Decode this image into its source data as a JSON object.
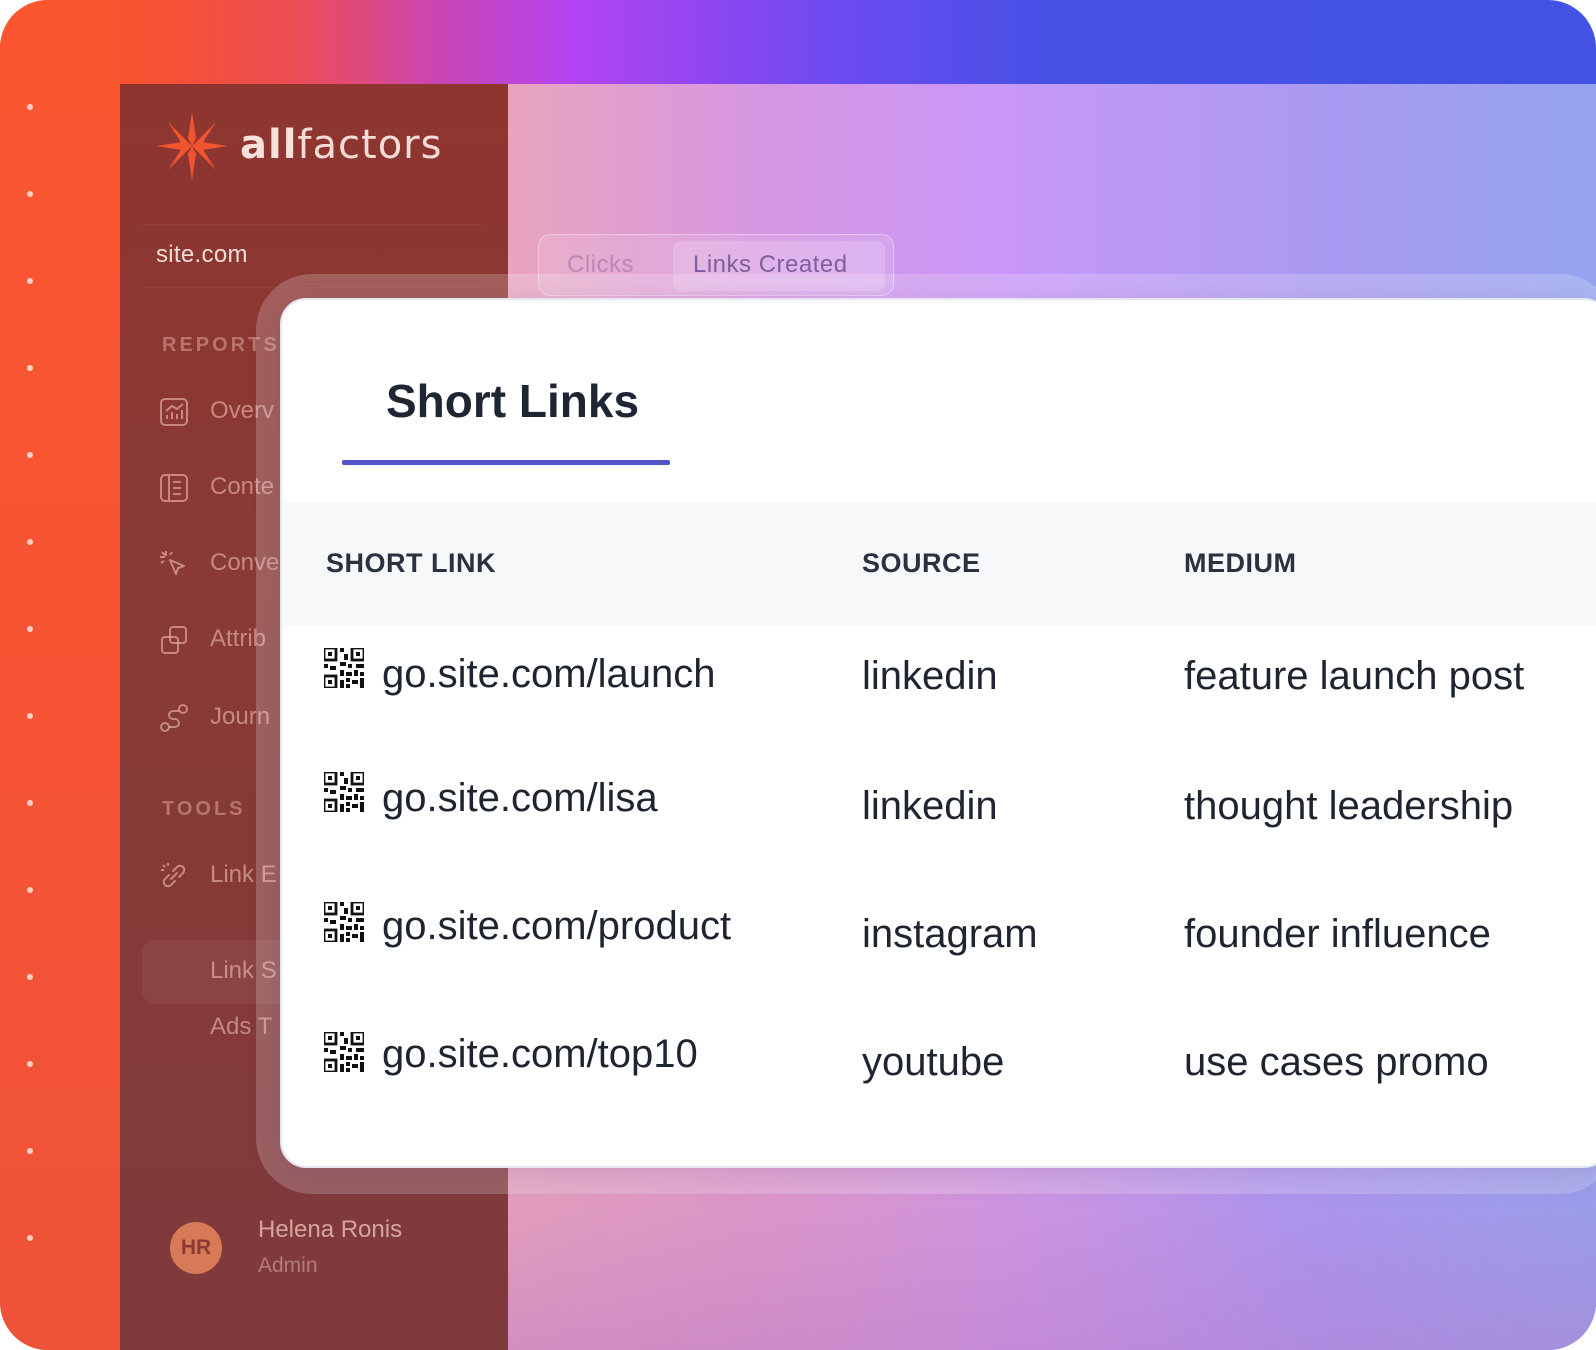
{
  "brand": {
    "name_bold": "all",
    "name_regular": "factors",
    "accent": "#f0532e"
  },
  "workspace": {
    "site": "site.com"
  },
  "sidebar": {
    "reports_label": "REPORTS",
    "tools_label": "TOOLS",
    "items": [
      {
        "label": "Overv",
        "icon": "chart-icon"
      },
      {
        "label": "Conte",
        "icon": "document-icon"
      },
      {
        "label": "Conve",
        "icon": "cursor-click-icon"
      },
      {
        "label": "Attrib",
        "icon": "stack-icon"
      },
      {
        "label": "Journ",
        "icon": "route-icon"
      }
    ],
    "tools": [
      {
        "label": "Link E",
        "icon": "link-icon"
      },
      {
        "label": "Link S",
        "icon": ""
      },
      {
        "label": "Ads T",
        "icon": ""
      }
    ]
  },
  "user": {
    "initials": "HR",
    "name": "Helena Ronis",
    "role": "Admin"
  },
  "toggle": {
    "option_1": "Clicks",
    "option_2": "Links Created",
    "selected": "Links Created"
  },
  "card": {
    "title": "Short Links",
    "columns": [
      "SHORT LINK",
      "SOURCE",
      "MEDIUM"
    ],
    "rows": [
      {
        "link": "go.site.com/launch",
        "source": "linkedin",
        "medium": "feature launch post"
      },
      {
        "link": "go.site.com/lisa",
        "source": "linkedin",
        "medium": "thought leadership"
      },
      {
        "link": "go.site.com/product",
        "source": "instagram",
        "medium": "founder influence"
      },
      {
        "link": "go.site.com/top10",
        "source": "youtube",
        "medium": "use cases promo"
      }
    ]
  },
  "colors": {
    "underline": "#4d55c9",
    "sidebar": "#8a3832"
  }
}
